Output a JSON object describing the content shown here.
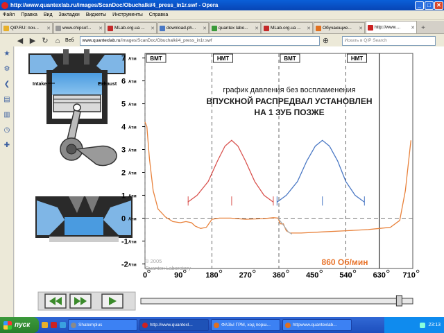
{
  "window": {
    "title": "http://www.quantexlab.ru/images/ScanDoc/Obuchalki/4_press_in1r.swf - Opera",
    "btn_min": "_",
    "btn_max": "□",
    "btn_close": "✕"
  },
  "menu": [
    "Файл",
    "Правка",
    "Вид",
    "Закладки",
    "Виджеты",
    "Инструменты",
    "Справка"
  ],
  "tabs": [
    {
      "label": "QIP.RU: поч...",
      "color": "#e8b02b"
    },
    {
      "label": "www.chipsof...",
      "color": "#999999"
    },
    {
      "label": "MLab.org.ua ...",
      "color": "#c42a2a"
    },
    {
      "label": "download.ph...",
      "color": "#4a78c4"
    },
    {
      "label": "quantex labo...",
      "color": "#3a9a3a"
    },
    {
      "label": "MLab.org.ua ...",
      "color": "#c42a2a"
    },
    {
      "label": "Обучающие...",
      "color": "#e07020"
    },
    {
      "label": "http://www....",
      "color": "#cc2222",
      "active": true
    }
  ],
  "address": {
    "be_label": "Веб",
    "url_host": "www.quantexlab.ru",
    "url_path": "/images/ScanDoc/Obuchalki/4_press_in1r.swf",
    "search_placeholder": "Искать в QIP Search"
  },
  "flash": {
    "engine_labels": {
      "intake": "Intake",
      "exhaust": "Exhaust"
    },
    "title_line1": "график давления без воспламенения",
    "title_line2": "ВПУСКНОЙ РАСПРЕДВАЛ УСТАНОВЛЕН",
    "title_line3": "НА 1 ЗУБ ПОЗЖЕ",
    "rpm": "860 Об/мин",
    "copyright1": "© 2005",
    "copyright2": "Quantex Laboratory"
  },
  "chart_data": {
    "type": "line",
    "y_ticks": [
      {
        "v": 7,
        "label": "7",
        "unit": "Атм"
      },
      {
        "v": 6,
        "label": "6",
        "unit": "Атм"
      },
      {
        "v": 5,
        "label": "5",
        "unit": "Атм"
      },
      {
        "v": 4,
        "label": "4",
        "unit": "Атм"
      },
      {
        "v": 3,
        "label": "3",
        "unit": "Атм"
      },
      {
        "v": 2,
        "label": "2",
        "unit": "Атм"
      },
      {
        "v": 1,
        "label": "1",
        "unit": "Атм"
      },
      {
        "v": 0,
        "label": "0",
        "unit": "Атм"
      },
      {
        "v": -1,
        "label": "-1",
        "unit": "Атм"
      },
      {
        "v": -2,
        "label": "-2",
        "unit": "Атм"
      }
    ],
    "x_ticks": [
      {
        "v": 0,
        "label": "0"
      },
      {
        "v": 90,
        "label": "90"
      },
      {
        "v": 180,
        "label": "180"
      },
      {
        "v": 270,
        "label": "270"
      },
      {
        "v": 360,
        "label": "360"
      },
      {
        "v": 450,
        "label": "450"
      },
      {
        "v": 540,
        "label": "540"
      },
      {
        "v": 630,
        "label": "630"
      },
      {
        "v": 710,
        "label": "710"
      }
    ],
    "xlim": [
      0,
      720
    ],
    "ylim": [
      -2.2,
      7.2
    ],
    "markers": [
      {
        "x": 0,
        "label": "ВМТ"
      },
      {
        "x": 180,
        "label": "НМТ"
      },
      {
        "x": 360,
        "label": "ВМТ"
      },
      {
        "x": 540,
        "label": "НМТ"
      }
    ],
    "red_line_x": 630,
    "series": [
      {
        "color": "#e8813a",
        "points": [
          [
            0,
            4.2
          ],
          [
            5,
            4.0
          ],
          [
            12,
            2.6
          ],
          [
            22,
            1.2
          ],
          [
            35,
            0.4
          ],
          [
            55,
            0.05
          ],
          [
            75,
            -0.15
          ],
          [
            95,
            -0.2
          ],
          [
            110,
            -0.15
          ],
          [
            125,
            -0.2
          ],
          [
            135,
            -0.35
          ],
          [
            150,
            -0.45
          ],
          [
            165,
            -0.4
          ],
          [
            180,
            -0.05
          ],
          [
            200,
            0.0
          ],
          [
            230,
            0.0
          ],
          [
            270,
            -0.05
          ],
          [
            320,
            -0.02
          ],
          [
            345,
            0.02
          ],
          [
            358,
            0.0
          ],
          [
            362,
            -0.2
          ],
          [
            365,
            -0.25
          ],
          [
            372,
            -0.25
          ],
          [
            380,
            -0.55
          ],
          [
            390,
            -0.65
          ],
          [
            420,
            -0.65
          ],
          [
            480,
            -0.6
          ],
          [
            540,
            -0.55
          ],
          [
            600,
            -0.5
          ],
          [
            630,
            -0.45
          ],
          [
            660,
            -0.4
          ],
          [
            685,
            -0.1
          ],
          [
            700,
            1.2
          ],
          [
            715,
            3.4
          ]
        ]
      },
      {
        "color": "#aaaaaa",
        "points": [
          [
            358,
            0.0
          ],
          [
            362,
            -0.1
          ],
          [
            372,
            -0.3
          ],
          [
            385,
            -0.6
          ],
          [
            395,
            -0.7
          ]
        ]
      },
      {
        "color": "#d9534f",
        "points": [
          [
            115,
            0.7
          ],
          [
            140,
            1.0
          ],
          [
            170,
            1.6
          ],
          [
            195,
            2.5
          ],
          [
            215,
            3.15
          ],
          [
            233,
            3.4
          ],
          [
            250,
            3.15
          ],
          [
            270,
            2.5
          ],
          [
            295,
            1.6
          ],
          [
            320,
            1.0
          ],
          [
            345,
            0.7
          ]
        ]
      },
      {
        "color": "#4a78c4",
        "points": [
          [
            355,
            0.7
          ],
          [
            380,
            1.0
          ],
          [
            410,
            1.6
          ],
          [
            435,
            2.5
          ],
          [
            458,
            3.15
          ],
          [
            477,
            3.4
          ],
          [
            496,
            3.15
          ],
          [
            518,
            2.5
          ],
          [
            540,
            1.6
          ],
          [
            565,
            1.0
          ],
          [
            590,
            0.7
          ]
        ]
      }
    ],
    "ticks_red": [
      116,
      233,
      345
    ],
    "ticks_blue": [
      355,
      477,
      590
    ]
  },
  "player": {
    "rewind_icon": "double-left",
    "ff_icon": "double-right",
    "play_icon": "play",
    "progress": 0.95
  },
  "taskbar": {
    "start": "пуск",
    "items": [
      {
        "label": "Shatemplus",
        "color": "#8a8a8a"
      },
      {
        "label": "http://www.quantexl...",
        "color": "#cc2222",
        "active": true
      },
      {
        "label": "ФАЗЫ ГРМ, ход порш...",
        "color": "#e07020"
      },
      {
        "label": "httpwww.quantexlab...",
        "color": "#e07020"
      }
    ],
    "clock": "23:13"
  }
}
